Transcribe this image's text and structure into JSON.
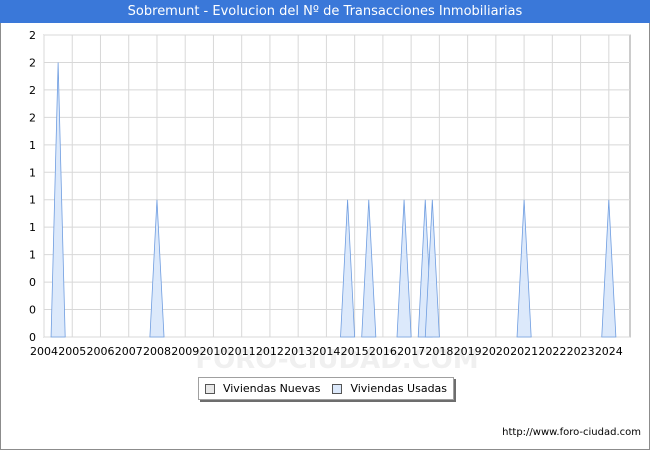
{
  "title": "Sobremunt - Evolucion del Nº de Transacciones Inmobiliarias",
  "footer_url": "http://www.foro-ciudad.com",
  "watermark": "FORO-CIUDAD.COM",
  "colors": {
    "title_bg": "#3a78d9",
    "nuevas_fill": "#e8e8e8",
    "usadas_fill": "#dce9fb",
    "usadas_stroke": "#6f9de0",
    "grid": "#d8d8d8"
  },
  "chart_data": {
    "type": "area",
    "title": "Sobremunt - Evolucion del Nº de Transacciones Inmobiliarias",
    "xlabel": "",
    "ylabel": "",
    "xlim": [
      2004,
      2024.75
    ],
    "ylim": [
      0,
      2.2
    ],
    "y_tick_values": [
      0,
      0.2,
      0.4,
      0.6,
      0.8,
      1.0,
      1.2,
      1.4,
      1.6,
      1.8,
      2.0,
      2.2
    ],
    "y_tick_labels": [
      "0",
      "0",
      "0",
      "1",
      "1",
      "1",
      "1",
      "1",
      "2",
      "2",
      "2",
      "2"
    ],
    "x_tick_labels": [
      "2004",
      "2005",
      "2006",
      "2007",
      "2008",
      "2009",
      "2010",
      "2011",
      "2012",
      "2013",
      "2014",
      "2015",
      "2016",
      "2017",
      "2018",
      "2019",
      "2020",
      "2021",
      "2022",
      "2023",
      "2024"
    ],
    "grid": true,
    "legend_position": "bottom-center",
    "series": [
      {
        "name": "Viviendas Nuevas",
        "points": []
      },
      {
        "name": "Viviendas Usadas",
        "points": [
          {
            "x": 2004.5,
            "y": 2
          },
          {
            "x": 2008.0,
            "y": 1
          },
          {
            "x": 2014.75,
            "y": 1
          },
          {
            "x": 2015.5,
            "y": 1
          },
          {
            "x": 2016.75,
            "y": 1
          },
          {
            "x": 2017.5,
            "y": 1
          },
          {
            "x": 2017.75,
            "y": 1
          },
          {
            "x": 2021.0,
            "y": 1
          },
          {
            "x": 2024.0,
            "y": 1
          }
        ]
      }
    ]
  }
}
